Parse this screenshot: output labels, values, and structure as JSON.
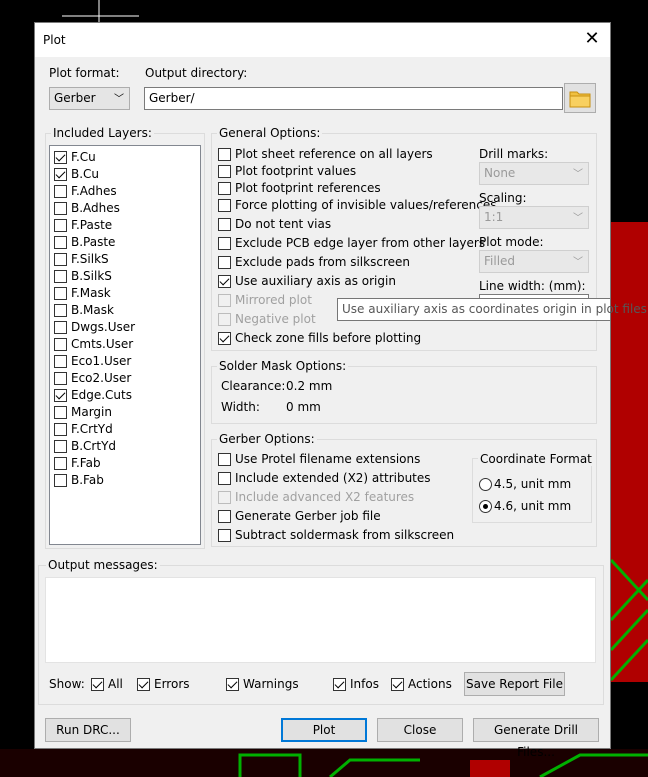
{
  "dialog": {
    "title": "Plot"
  },
  "plot_format": {
    "label": "Plot format:",
    "value": "Gerber"
  },
  "output_directory": {
    "label": "Output directory:",
    "value": "Gerber/"
  },
  "included_layers": {
    "label": "Included Layers:",
    "items": [
      {
        "name": "F.Cu",
        "checked": true
      },
      {
        "name": "B.Cu",
        "checked": true
      },
      {
        "name": "F.Adhes",
        "checked": false
      },
      {
        "name": "B.Adhes",
        "checked": false
      },
      {
        "name": "F.Paste",
        "checked": false
      },
      {
        "name": "B.Paste",
        "checked": false
      },
      {
        "name": "F.SilkS",
        "checked": false
      },
      {
        "name": "B.SilkS",
        "checked": false
      },
      {
        "name": "F.Mask",
        "checked": false
      },
      {
        "name": "B.Mask",
        "checked": false
      },
      {
        "name": "Dwgs.User",
        "checked": false
      },
      {
        "name": "Cmts.User",
        "checked": false
      },
      {
        "name": "Eco1.User",
        "checked": false
      },
      {
        "name": "Eco2.User",
        "checked": false
      },
      {
        "name": "Edge.Cuts",
        "checked": true
      },
      {
        "name": "Margin",
        "checked": false
      },
      {
        "name": "F.CrtYd",
        "checked": false
      },
      {
        "name": "B.CrtYd",
        "checked": false
      },
      {
        "name": "F.Fab",
        "checked": false
      },
      {
        "name": "B.Fab",
        "checked": false
      }
    ]
  },
  "general_options": {
    "label": "General Options:",
    "items": [
      {
        "label": "Plot sheet reference on all layers",
        "checked": false,
        "disabled": false
      },
      {
        "label": "Plot footprint values",
        "checked": false,
        "disabled": false
      },
      {
        "label": "Plot footprint references",
        "checked": false,
        "disabled": false
      },
      {
        "label": "Force plotting of invisible values/references",
        "checked": false,
        "disabled": false
      },
      {
        "label": "Do not tent vias",
        "checked": false,
        "disabled": false
      },
      {
        "label": "Exclude PCB edge layer from other layers",
        "checked": false,
        "disabled": false
      },
      {
        "label": "Exclude pads from silkscreen",
        "checked": false,
        "disabled": false
      },
      {
        "label": "Use auxiliary axis as origin",
        "checked": true,
        "disabled": false
      },
      {
        "label": "Mirrored plot",
        "checked": false,
        "disabled": true
      },
      {
        "label": "Negative plot",
        "checked": false,
        "disabled": true
      },
      {
        "label": "Check zone fills before plotting",
        "checked": true,
        "disabled": false
      }
    ],
    "drill_marks": {
      "label": "Drill marks:",
      "value": "None"
    },
    "scaling": {
      "label": "Scaling:",
      "value": "1:1"
    },
    "plot_mode": {
      "label": "Plot mode:",
      "value": "Filled"
    },
    "line_width": {
      "label": "Line width: (mm):",
      "value": ""
    }
  },
  "tooltip": {
    "text": "Use auxiliary axis as coordinates origin in plot files"
  },
  "solder_mask": {
    "label": "Solder Mask Options:",
    "clearance_label": "Clearance:",
    "clearance_value": "0.2 mm",
    "width_label": "Width:",
    "width_value": "0 mm"
  },
  "gerber_options": {
    "label": "Gerber Options:",
    "items": [
      {
        "label": "Use Protel filename extensions",
        "checked": false,
        "disabled": false
      },
      {
        "label": "Include extended (X2) attributes",
        "checked": false,
        "disabled": false
      },
      {
        "label": "Include advanced X2 features",
        "checked": false,
        "disabled": true
      },
      {
        "label": "Generate Gerber job file",
        "checked": false,
        "disabled": false
      },
      {
        "label": "Subtract soldermask from silkscreen",
        "checked": false,
        "disabled": false
      }
    ],
    "coordinate_format": {
      "label": "Coordinate Format",
      "options": [
        {
          "label": "4.5, unit mm",
          "selected": false
        },
        {
          "label": "4.6, unit mm",
          "selected": true
        }
      ]
    }
  },
  "output_messages": {
    "label": "Output messages:",
    "show_label": "Show:",
    "filters": [
      {
        "label": "All",
        "checked": true
      },
      {
        "label": "Errors",
        "checked": true
      },
      {
        "label": "Warnings",
        "checked": true
      },
      {
        "label": "Infos",
        "checked": true
      },
      {
        "label": "Actions",
        "checked": true
      }
    ],
    "save_report": "Save Report File"
  },
  "buttons": {
    "run_drc": "Run DRC...",
    "plot": "Plot",
    "close": "Close",
    "generate_drill": "Generate Drill Files..."
  },
  "colors": {
    "pcb_red": "#b00000",
    "track_green": "#00b000",
    "accent": "#0078d7"
  }
}
